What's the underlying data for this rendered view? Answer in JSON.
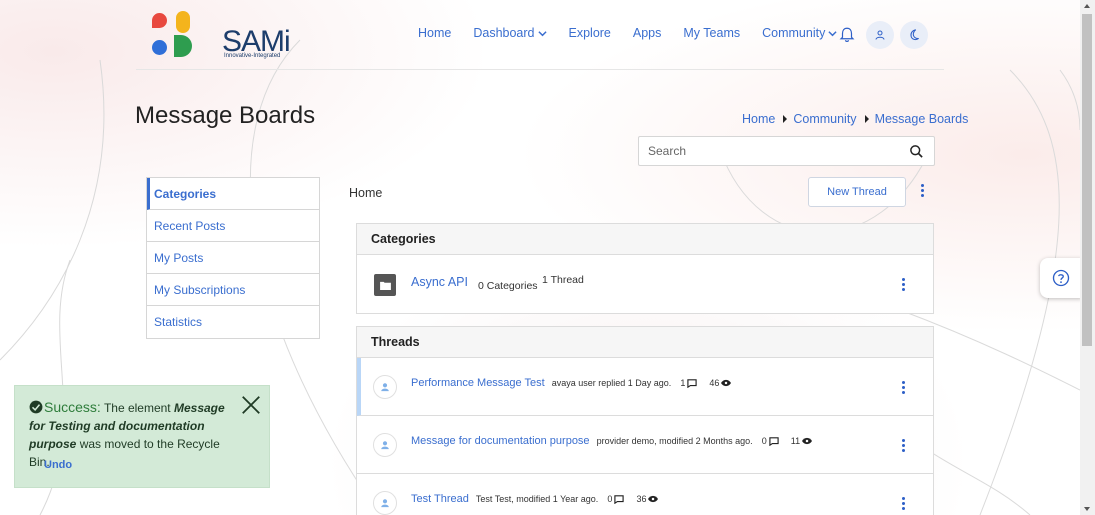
{
  "app": {
    "logo_text": "SAMi",
    "logo_subtitle": "Innovative-Integrated"
  },
  "nav": {
    "items": [
      {
        "label": "Home"
      },
      {
        "label": "Dashboard",
        "dropdown": true
      },
      {
        "label": "Explore"
      },
      {
        "label": "Apps"
      },
      {
        "label": "My Teams"
      },
      {
        "label": "Community",
        "dropdown": true
      }
    ],
    "icons": [
      "bell-icon",
      "user-icon",
      "moon-icon"
    ]
  },
  "page": {
    "title": "Message Boards",
    "breadcrumb": [
      "Home",
      "Community",
      "Message Boards"
    ]
  },
  "search": {
    "placeholder": "Search",
    "value": ""
  },
  "sidebar": {
    "items": [
      {
        "label": "Categories",
        "active": true
      },
      {
        "label": "Recent Posts"
      },
      {
        "label": "My Posts"
      },
      {
        "label": "My Subscriptions"
      },
      {
        "label": "Statistics"
      }
    ]
  },
  "main": {
    "location": "Home",
    "new_thread_label": "New Thread",
    "categories_heading": "Categories",
    "categories": [
      {
        "name": "Async API",
        "count": "0 Categories",
        "threads": "1 Thread"
      }
    ],
    "threads_heading": "Threads",
    "threads": [
      {
        "title": "Performance Message Test",
        "meta": "avaya user replied 1 Day ago.",
        "replies": "1",
        "views": "46"
      },
      {
        "title": "Message for documentation purpose",
        "meta": "provider demo, modified 2 Months ago.",
        "replies": "0",
        "views": "11"
      },
      {
        "title": "Test Thread",
        "meta": "Test Test, modified 1 Year ago.",
        "replies": "0",
        "views": "36"
      }
    ]
  },
  "toast": {
    "title": "Success:",
    "message_pre": "The element",
    "element_name": "Message for Testing and documentation purpose",
    "message_post": "was moved to the Recycle Bin.",
    "undo_label": "Undo"
  },
  "colors": {
    "accent": "#3a6ecf",
    "toast_bg": "#d3ead7",
    "logo_red": "#e8493f",
    "logo_yellow": "#f4b41c",
    "logo_blue": "#2f6fd8",
    "logo_green": "#2e9d4f"
  }
}
